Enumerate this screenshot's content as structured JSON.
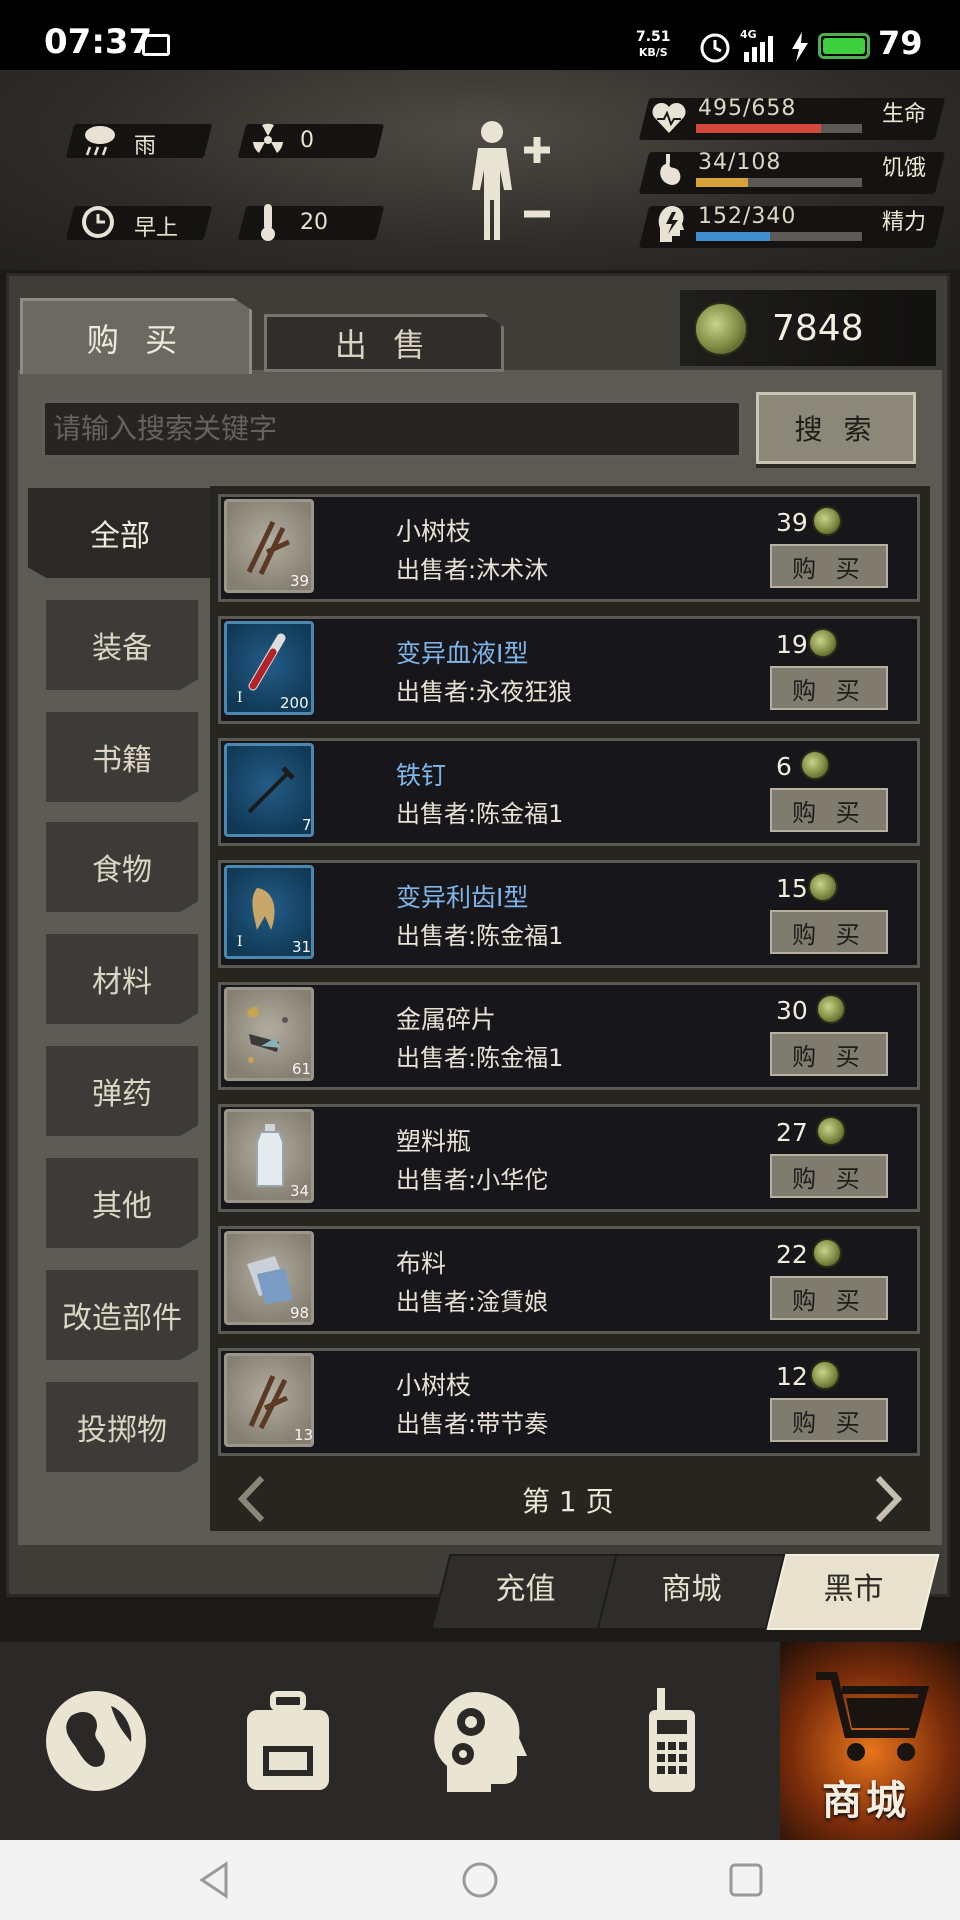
{
  "status_bar": {
    "time": "07:37",
    "net_speed_top": "7.51",
    "net_speed_bottom": "KB/S",
    "network": "4G",
    "battery": "79"
  },
  "hud": {
    "weather": "雨",
    "radiation": "0",
    "time_of_day": "早上",
    "temperature": "20",
    "stats": [
      {
        "value": "495/658",
        "name": "生命",
        "fraction": 0.752,
        "color": "#d24a3c",
        "icon": "heart-icon"
      },
      {
        "value": "34/108",
        "name": "饥饿",
        "fraction": 0.315,
        "color": "#d7a23a",
        "icon": "stomach-icon"
      },
      {
        "value": "152/340",
        "name": "精力",
        "fraction": 0.447,
        "color": "#3d8fd0",
        "icon": "energy-icon"
      }
    ]
  },
  "shop": {
    "tabs": {
      "buy": "购 买",
      "sell": "出 售"
    },
    "currency": "7848",
    "search": {
      "placeholder": "请输入搜索关键字",
      "button": "搜 索"
    },
    "categories": [
      "全部",
      "装备",
      "书籍",
      "食物",
      "材料",
      "弹药",
      "其他",
      "改造部件",
      "投掷物"
    ],
    "active_category": "全部",
    "items": [
      {
        "name": "小树枝",
        "seller": "出售者:沐术沐",
        "price": "39",
        "qty": "39",
        "rarity": "common",
        "icon": "twig-icon",
        "buy": "购 买"
      },
      {
        "name": "变异血液Ⅰ型",
        "seller": "出售者:永夜狂狼",
        "price": "19",
        "qty": "200",
        "rarity": "rare",
        "icon": "blood-vial-icon",
        "buy": "购 买"
      },
      {
        "name": "铁钉",
        "seller": "出售者:陈金福1",
        "price": "6",
        "qty": "7",
        "rarity": "rare",
        "icon": "nail-icon",
        "buy": "购 买"
      },
      {
        "name": "变异利齿Ⅰ型",
        "seller": "出售者:陈金福1",
        "price": "15",
        "qty": "31",
        "rarity": "rare",
        "icon": "fang-icon",
        "buy": "购 买"
      },
      {
        "name": "金属碎片",
        "seller": "出售者:陈金福1",
        "price": "30",
        "qty": "61",
        "rarity": "common",
        "icon": "metal-scrap-icon",
        "buy": "购 买"
      },
      {
        "name": "塑料瓶",
        "seller": "出售者:小华佗",
        "price": "27",
        "qty": "34",
        "rarity": "common",
        "icon": "plastic-bottle-icon",
        "buy": "购 买"
      },
      {
        "name": "布料",
        "seller": "出售者:淦賃娘",
        "price": "22",
        "qty": "98",
        "rarity": "common",
        "icon": "cloth-icon",
        "buy": "购 买"
      },
      {
        "name": "小树枝",
        "seller": "出售者:带节奏",
        "price": "12",
        "qty": "13",
        "rarity": "common",
        "icon": "twig-icon",
        "buy": "购 买"
      }
    ],
    "pager": "第 1 页",
    "bottom_tabs": [
      "充值",
      "商城",
      "黑市"
    ],
    "active_bottom_tab": "黑市"
  },
  "nav": {
    "shop_label": "商城"
  }
}
